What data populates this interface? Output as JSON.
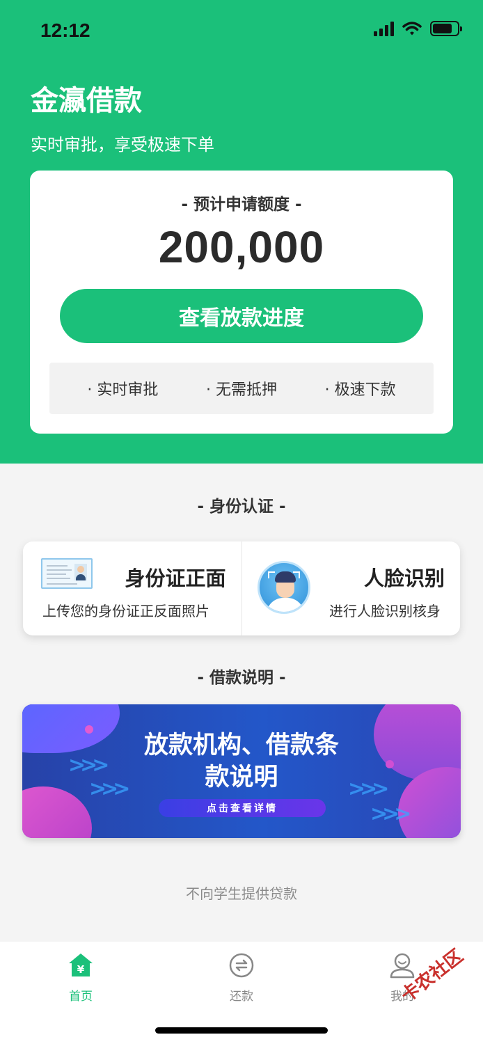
{
  "status_bar": {
    "time": "12:12"
  },
  "header": {
    "title": "金瀛借款",
    "subtitle": "实时审批，享受极速下单"
  },
  "quota_card": {
    "label": "- 预计申请额度 -",
    "amount": "200,000",
    "button_label": "查看放款进度",
    "features": [
      "· 实时审批",
      "· 无需抵押",
      "· 极速下款"
    ]
  },
  "identity_section": {
    "title": "- 身份认证 -",
    "items": [
      {
        "title": "身份证正面",
        "description": "上传您的身份证正反面照片",
        "icon": "id-card-icon"
      },
      {
        "title": "人脸识别",
        "description": "进行人脸识别核身",
        "icon": "face-recognition-icon"
      }
    ]
  },
  "loan_section": {
    "title": "- 借款说明 -",
    "banner_title_line1": "放款机构、借款条",
    "banner_title_line2": "款说明",
    "banner_button": "点击查看详情"
  },
  "notice": "不向学生提供贷款",
  "tab_bar": {
    "items": [
      {
        "label": "首页",
        "icon": "home-icon",
        "active": true
      },
      {
        "label": "还款",
        "icon": "repay-icon",
        "active": false
      },
      {
        "label": "我的",
        "icon": "profile-icon",
        "active": false
      }
    ]
  },
  "watermark": "卡农社区",
  "colors": {
    "brand_green": "#1bc07a",
    "banner_blue": "#2357c9",
    "banner_pink": "#d146b6"
  }
}
